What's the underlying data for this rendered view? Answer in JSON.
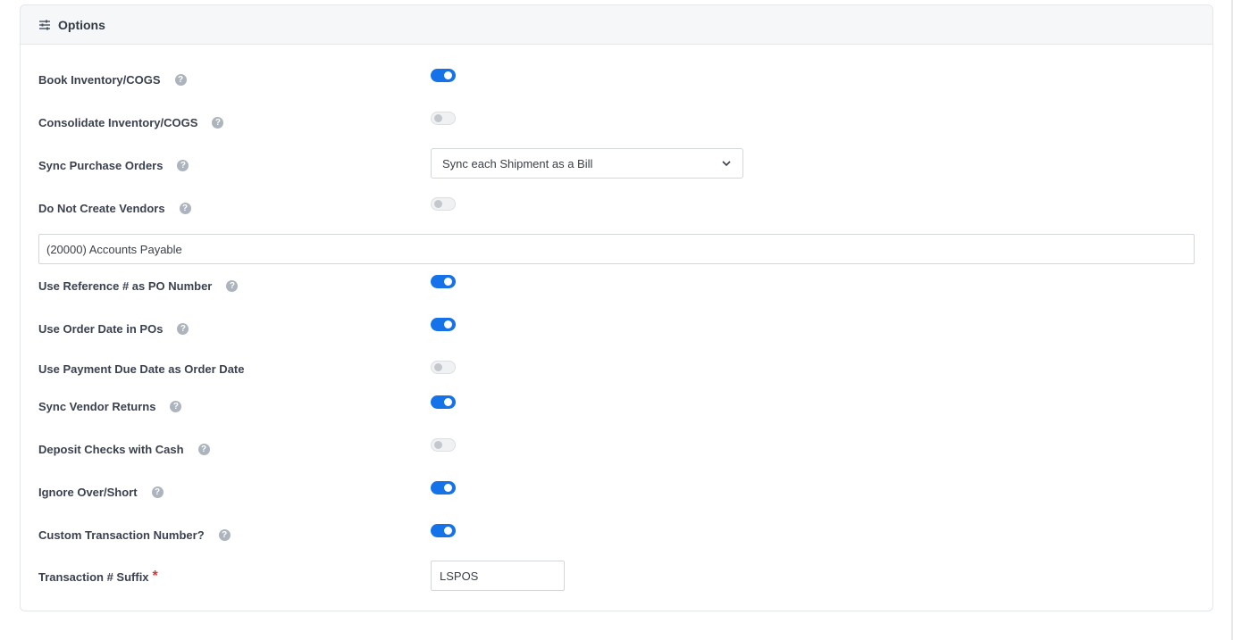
{
  "header": {
    "title": "Options",
    "icon": "sliders-icon"
  },
  "rows": [
    {
      "label": "Book Inventory/COGS",
      "help": true,
      "toggle": true
    },
    {
      "label": "Consolidate Inventory/COGS",
      "help": true,
      "toggle": false
    },
    {
      "label": "Sync Purchase Orders",
      "help": true
    },
    {
      "label": "Do Not Create Vendors",
      "help": true,
      "toggle": false
    },
    {
      "label": "Use Reference # as PO Number",
      "help": true,
      "toggle": true
    },
    {
      "label": "Use Order Date in POs",
      "help": true,
      "toggle": true
    },
    {
      "label": "Use Payment Due Date as Order Date",
      "help": false,
      "toggle": false
    },
    {
      "label": "Sync Vendor Returns",
      "help": true,
      "toggle": true
    },
    {
      "label": "Deposit Checks with Cash",
      "help": true,
      "toggle": false
    },
    {
      "label": "Ignore Over/Short",
      "help": true,
      "toggle": true
    },
    {
      "label": "Custom Transaction Number?",
      "help": true,
      "toggle": true
    },
    {
      "label": "Transaction # Suffix",
      "required": "*"
    }
  ],
  "help_glyph": "?",
  "sync_po_select": {
    "value": "Sync each Shipment as a Bill"
  },
  "accounts_payable": {
    "value": "(20000) Accounts Payable"
  },
  "suffix": {
    "value": "LSPOS"
  },
  "colors": {
    "toggle_on": "#1672e8",
    "required": "#e0312f",
    "help": "#aeb4bd"
  }
}
